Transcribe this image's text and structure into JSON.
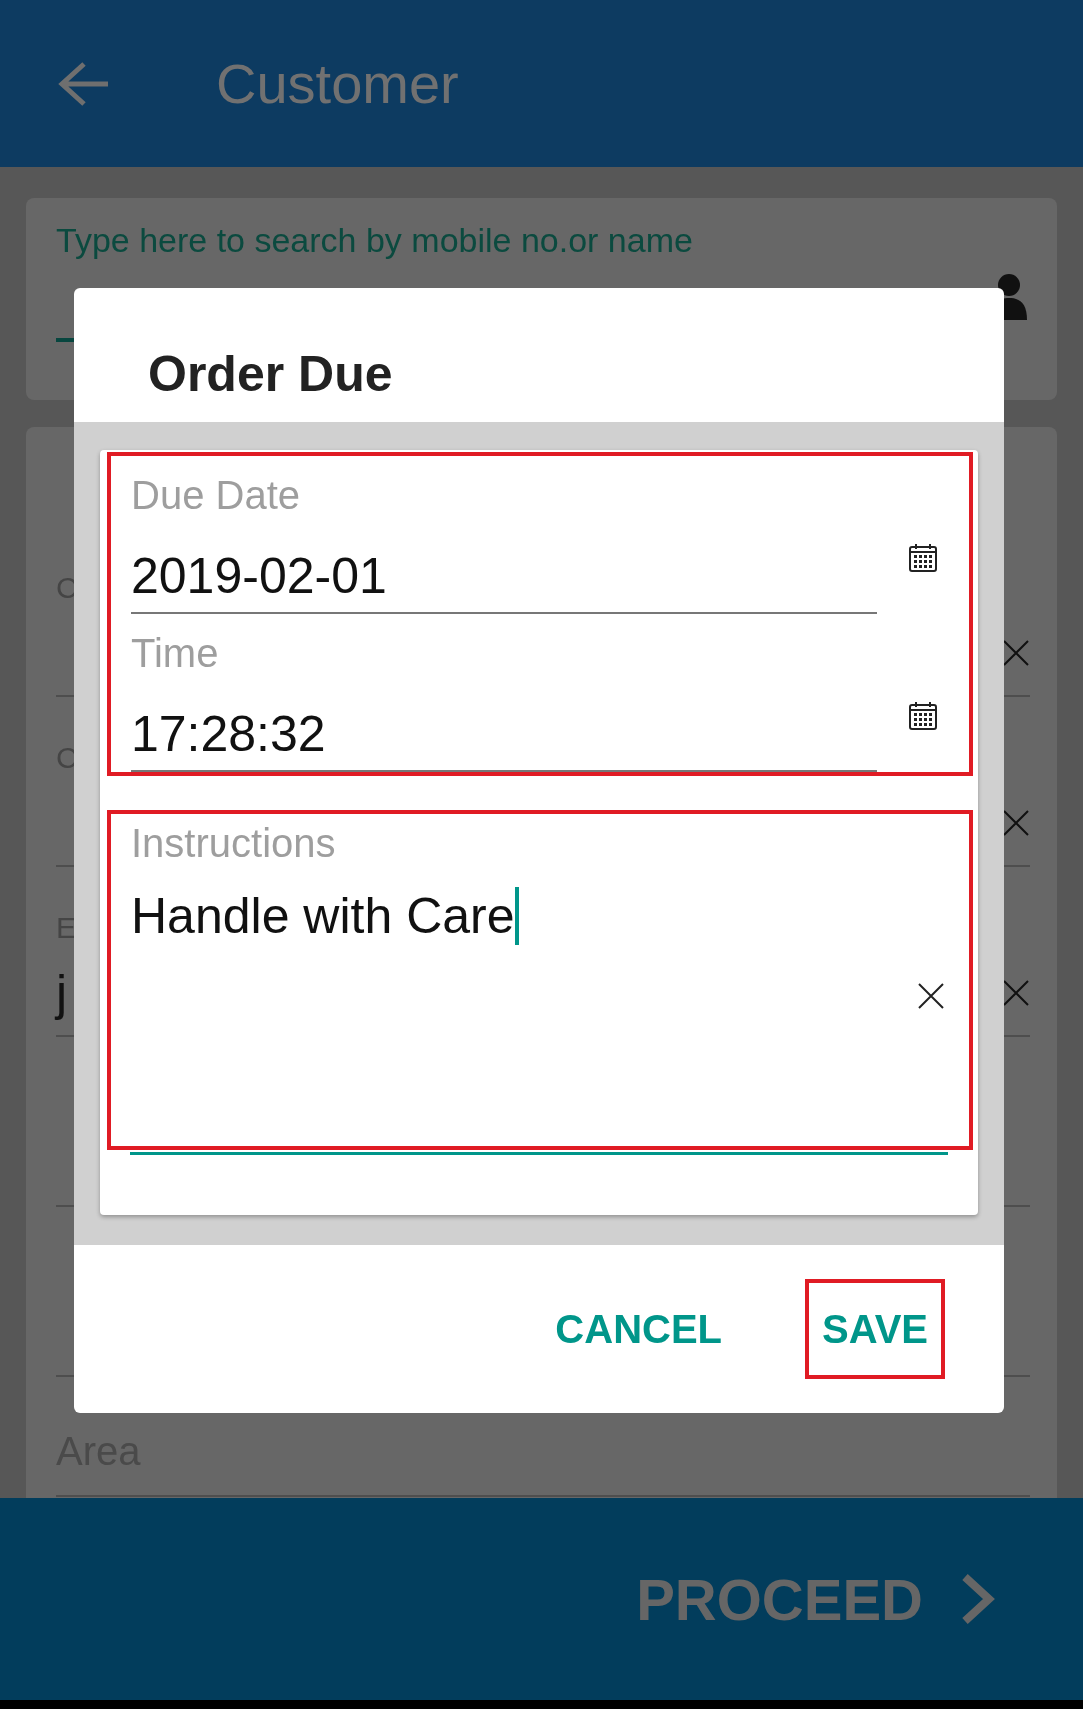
{
  "app_bar": {
    "title": "Customer"
  },
  "search": {
    "label": "Type here to search by mobile no.or name"
  },
  "background_fields": [
    {
      "kind": "blank"
    },
    {
      "kind": "filled",
      "label": "C"
    },
    {
      "kind": "filled",
      "label": "C"
    },
    {
      "kind": "filled",
      "label": "E",
      "value": "j"
    },
    {
      "kind": "hint"
    },
    {
      "kind": "hint"
    },
    {
      "kind": "hint",
      "label": "Area"
    }
  ],
  "dialog": {
    "title": "Order Due",
    "groups": [
      {
        "highlighted": true,
        "fields": [
          {
            "kind": "date",
            "label": "Due Date",
            "value": "2019-02-01",
            "focused": false
          },
          {
            "kind": "date",
            "label": "Time",
            "value": "17:28:32",
            "focused": false
          }
        ]
      },
      {
        "highlighted": true,
        "fields": [
          {
            "kind": "multiline",
            "label": "Instructions",
            "value": "Handle with Care",
            "focused": true
          }
        ]
      }
    ],
    "buttons": [
      {
        "label": "CANCEL",
        "highlighted": false
      },
      {
        "label": "SAVE",
        "highlighted": true
      }
    ]
  },
  "footer": {
    "button": "PROCEED"
  }
}
